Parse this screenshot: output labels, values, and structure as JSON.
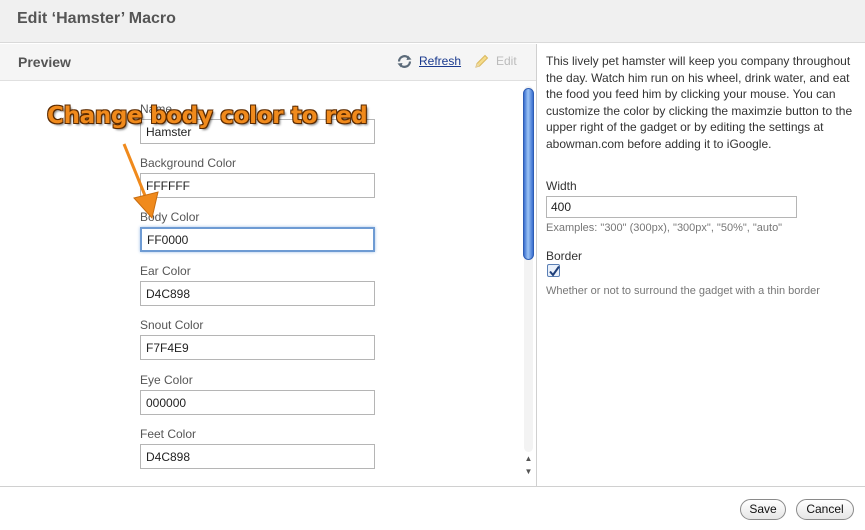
{
  "dialog": {
    "title": "Edit ‘Hamster’ Macro"
  },
  "preview": {
    "title": "Preview",
    "refresh_label": "Refresh",
    "edit_label": "Edit"
  },
  "callout": "Change body color to red",
  "fields": [
    {
      "label": "Name",
      "value": "Hamster"
    },
    {
      "label": "Background Color",
      "value": "FFFFFF"
    },
    {
      "label": "Body Color",
      "value": "FF0000"
    },
    {
      "label": "Ear Color",
      "value": "D4C898"
    },
    {
      "label": "Snout Color",
      "value": "F7F4E9"
    },
    {
      "label": "Eye Color",
      "value": "000000"
    },
    {
      "label": "Feet Color",
      "value": "D4C898"
    }
  ],
  "settings": {
    "description": "This lively pet hamster will keep you company throughout the day. Watch him run on his wheel, drink water, and eat the food you feed him by clicking your mouse. You can customize the color by clicking the maximzie button to the upper right of the gadget or by editing the settings at abowman.com before adding it to iGoogle.",
    "width_label": "Width",
    "width_value": "400",
    "width_hint": "Examples: \"300\" (300px), \"300px\", \"50%\", \"auto\"",
    "border_label": "Border",
    "border_checked": true,
    "border_hint": "Whether or not to surround the gadget with a thin border"
  },
  "footer": {
    "save_label": "Save",
    "cancel_label": "Cancel"
  },
  "colors": {
    "focus_ring": "#6e9bd3",
    "link": "#1a3a8f",
    "callout": "#f08a1c",
    "scroll_thumb": "#3a6fd0"
  }
}
